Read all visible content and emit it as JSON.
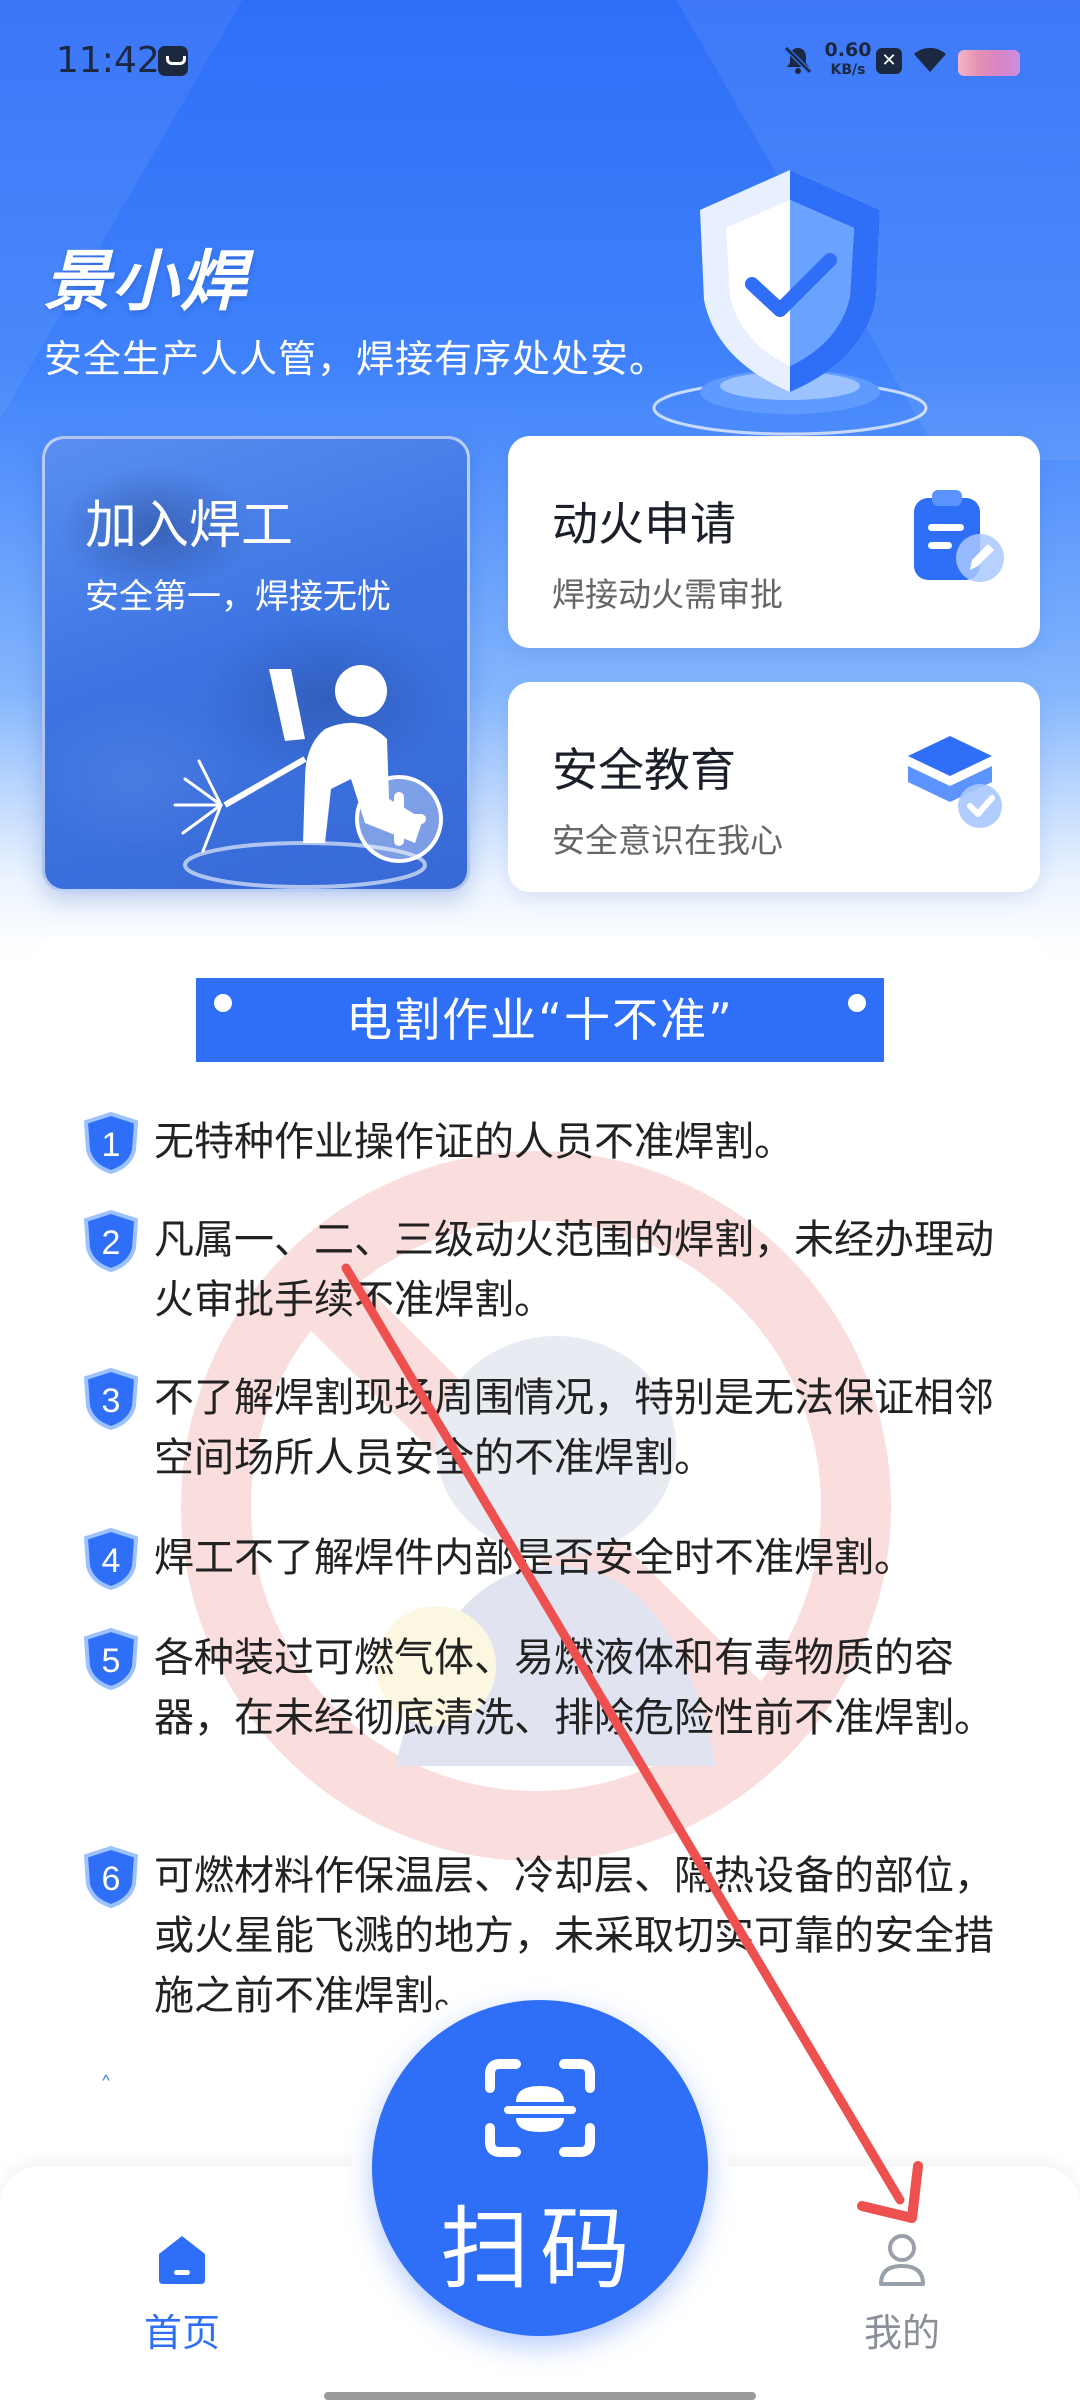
{
  "status_bar": {
    "time": "11:42",
    "speed_value": "0.60",
    "speed_unit": "KB/s",
    "icons": [
      "sim-card-icon",
      "mute-bell-icon",
      "close-badge-icon",
      "wifi-icon",
      "battery-icon"
    ]
  },
  "header": {
    "title": "景小焊",
    "slogan": "安全生产人人管，焊接有序处处安。"
  },
  "join_card": {
    "title": "加入焊工",
    "subtitle": "安全第一，焊接无忧"
  },
  "fire_card": {
    "title": "动火申请",
    "subtitle": "焊接动火需审批"
  },
  "edu_card": {
    "title": "安全教育",
    "subtitle": "安全意识在我心"
  },
  "rules": {
    "title": "电割作业“十不准”",
    "items": [
      {
        "num": "1",
        "text": "无特种作业操作证的人员不准焊割。"
      },
      {
        "num": "2",
        "text": "凡属一、二、三级动火范围的焊割，未经办理动火审批手续不准焊割。"
      },
      {
        "num": "3",
        "text": "不了解焊割现场周围情况，特别是无法保证相邻空间场所人员安全的不准焊割。"
      },
      {
        "num": "4",
        "text": "焊工不了解焊件内部是否安全时不准焊割。"
      },
      {
        "num": "5",
        "text": "各种装过可燃气体、易燃液体和有毒物质的容器，在未经彻底清洗、排除危险性前不准焊割。"
      },
      {
        "num": "6",
        "text": "可燃材料作保温层、冷却层、隔热设备的部位，或火星能飞溅的地方，未采取切实可靠的安全措施之前不准焊割。"
      }
    ]
  },
  "scan": {
    "label": "扫码"
  },
  "tabbar": {
    "home": "首页",
    "mine": "我的"
  },
  "colors": {
    "primary": "#2f6ef7",
    "annotation_arrow": "#ee4f4f",
    "inactive_tab": "#8a8f99"
  }
}
